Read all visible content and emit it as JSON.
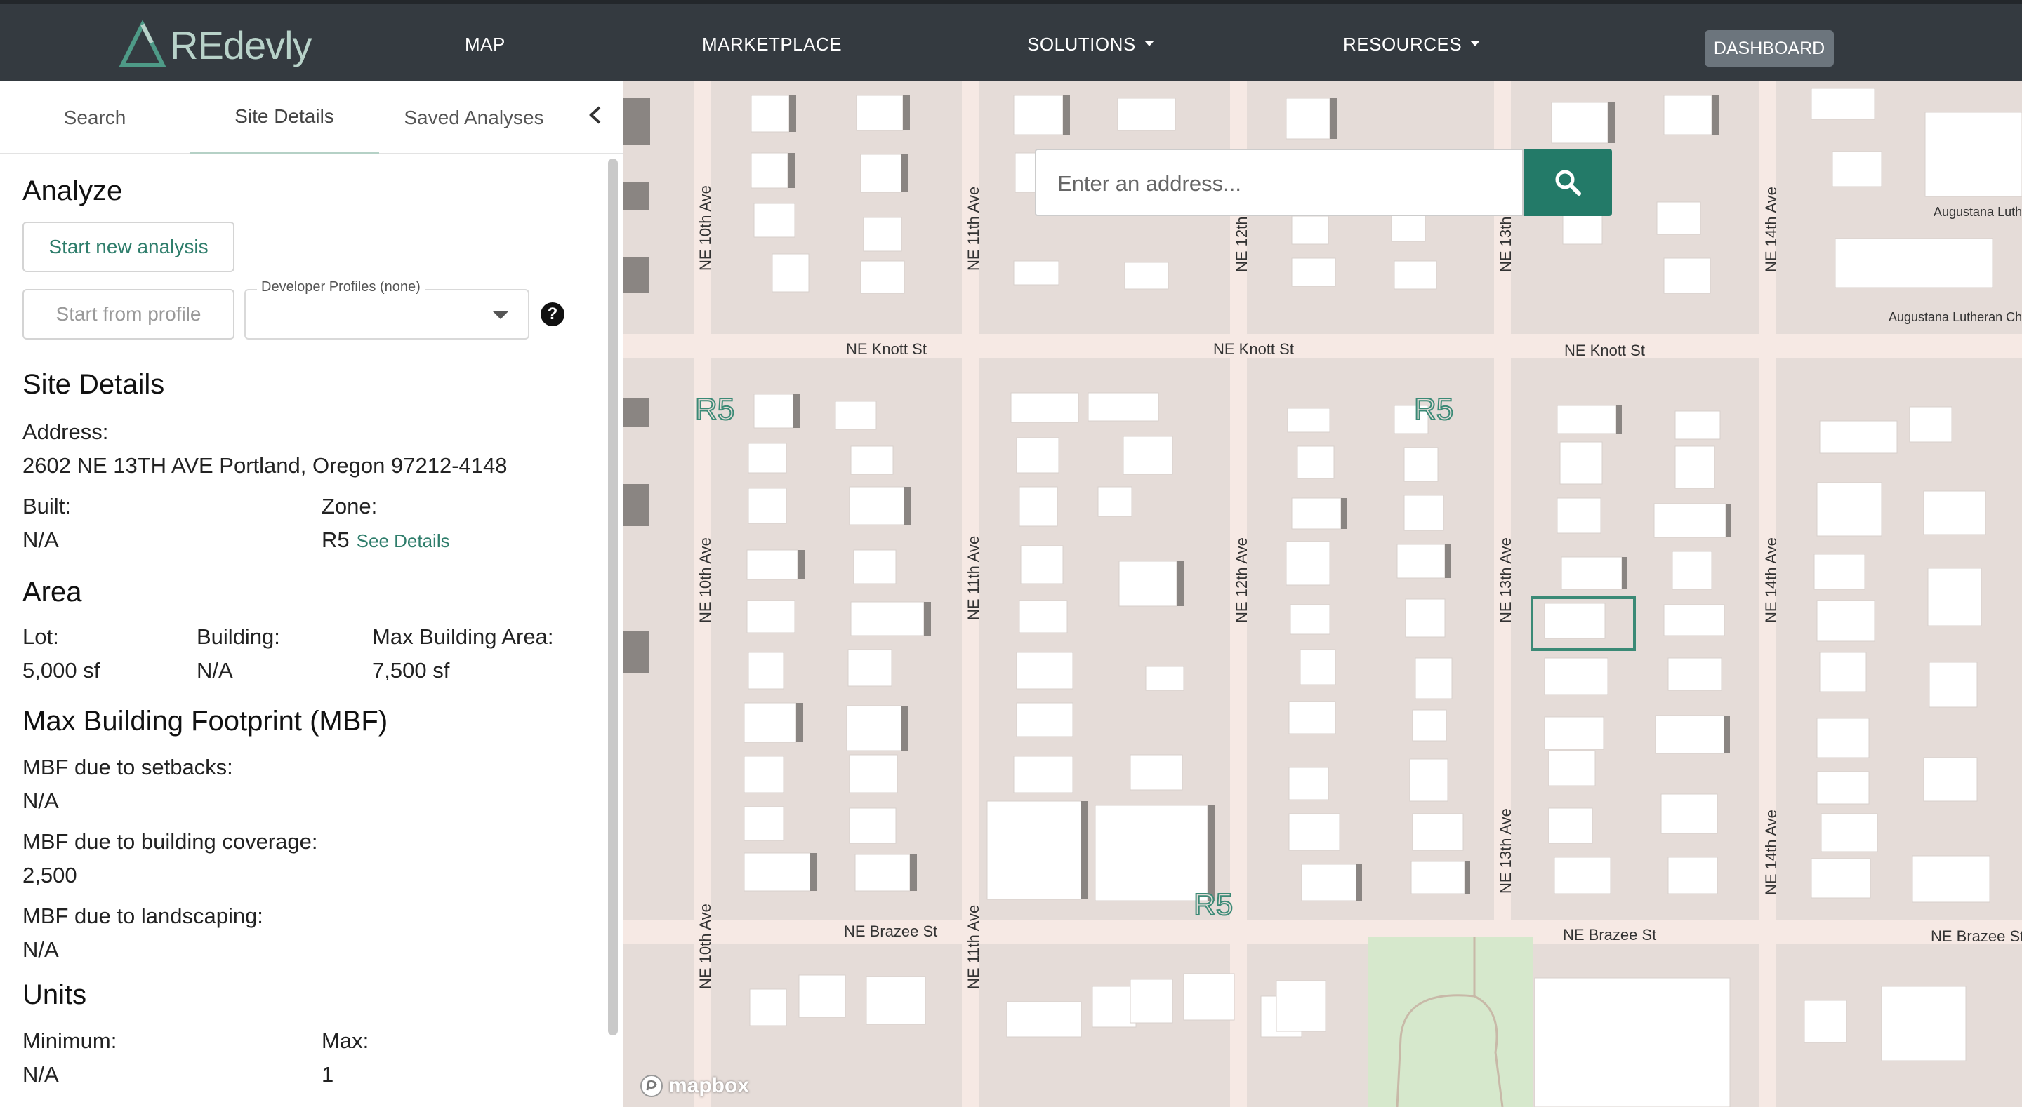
{
  "nav": {
    "logo_text": "REdevly",
    "items": [
      "MAP",
      "MARKETPLACE",
      "SOLUTIONS",
      "RESOURCES"
    ],
    "dashboard": "DASHBOARD"
  },
  "sidebar": {
    "tabs": [
      "Search",
      "Site Details",
      "Saved Analyses"
    ],
    "analyze": {
      "title": "Analyze",
      "start_new": "Start new analysis",
      "start_profile": "Start from profile",
      "profiles_label": "Developer Profiles (none)"
    },
    "site_details": {
      "title": "Site Details",
      "address_label": "Address:",
      "address": "2602 NE 13TH AVE Portland, Oregon 97212-4148",
      "built_label": "Built:",
      "built": "N/A",
      "zone_label": "Zone:",
      "zone": "R5",
      "zone_link": "See Details"
    },
    "area": {
      "title": "Area",
      "lot_label": "Lot:",
      "lot": "5,000 sf",
      "building_label": "Building:",
      "building": "N/A",
      "max_label": "Max Building Area:",
      "max": "7,500 sf"
    },
    "mbf": {
      "title": "Max Building Footprint (MBF)",
      "setbacks_label": "MBF due to setbacks:",
      "setbacks": "N/A",
      "coverage_label": "MBF due to building coverage:",
      "coverage": "2,500",
      "landscaping_label": "MBF due to landscaping:",
      "landscaping": "N/A"
    },
    "units": {
      "title": "Units",
      "min_label": "Minimum:",
      "min": "N/A",
      "max_label": "Max:",
      "max": "1"
    }
  },
  "map": {
    "search_placeholder": "Enter an address...",
    "streets": {
      "knott": "NE Knott St",
      "brazee": "NE Brazee St",
      "ave10": "NE 10th Ave",
      "ave11": "NE 11th Ave",
      "ave12": "NE 12th Ave",
      "ave13": "NE 13th Ave",
      "ave13_short": "NE 13th A",
      "ave14": "NE 14th Ave"
    },
    "zone_label": "R5",
    "poi_1": "Augustana Luthera",
    "poi_2": "Augustana Lutheran Church",
    "attribution": "mapbox"
  },
  "colors": {
    "accent": "#237a68",
    "navbar": "#343a40",
    "map_bg": "#e5dcd8",
    "road": "#f6e9e4",
    "park": "#d6e8cc"
  }
}
